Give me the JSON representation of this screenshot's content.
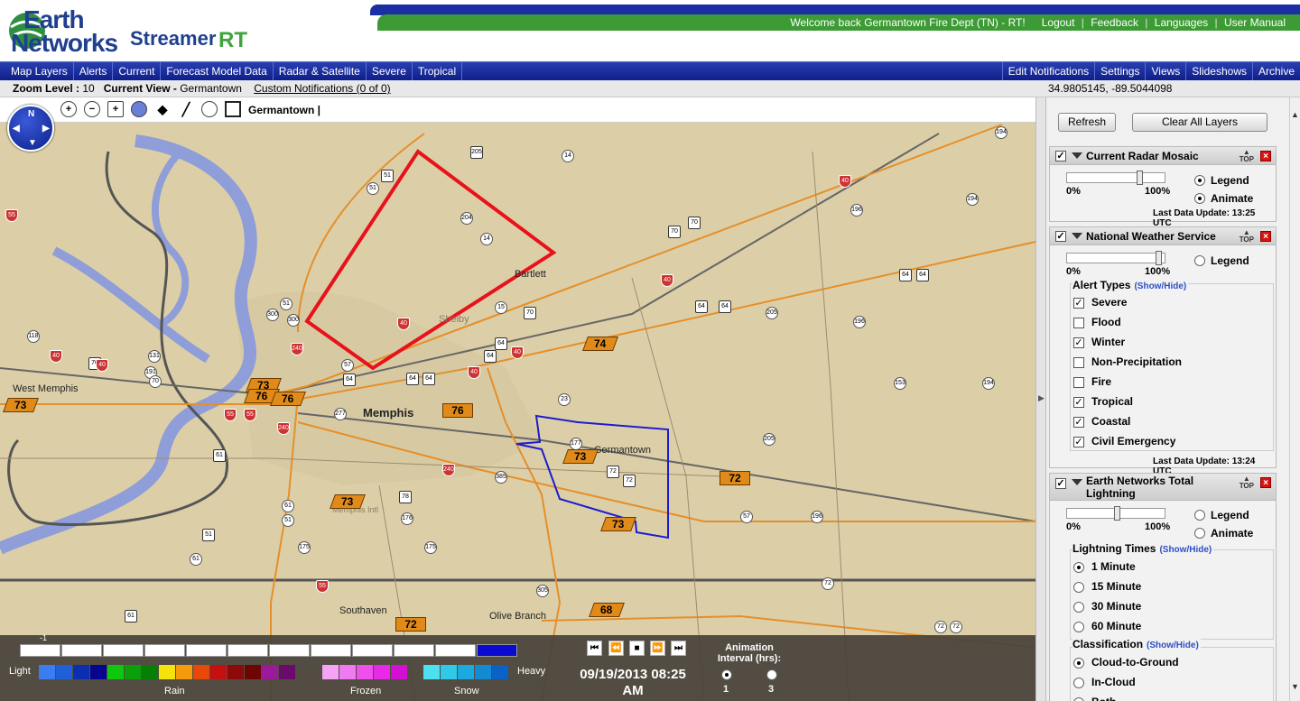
{
  "brand": {
    "line1": "Earth",
    "line2": "Networks",
    "product": "Streamer",
    "suffix": "RT"
  },
  "topbar": {
    "welcome": "Welcome back  Germantown Fire Dept (TN) - RT!",
    "links": [
      "Logout",
      "Feedback",
      "Languages",
      "User Manual"
    ]
  },
  "nav": {
    "left": [
      "Map Layers",
      "Alerts",
      "Current",
      "Forecast Model Data",
      "Radar & Satellite",
      "Severe",
      "Tropical"
    ],
    "right": [
      "Edit Notifications",
      "Settings",
      "Views",
      "Slideshows",
      "Archive"
    ]
  },
  "info": {
    "zoom_label": "Zoom Level :",
    "zoom_value": "10",
    "view_label": "Current View -",
    "view_value": "Germantown",
    "custom_notif": "Custom Notifications (0 of 0)",
    "coords": "34.9805145, -89.5044098"
  },
  "map": {
    "location_label": "Germantown",
    "cities": {
      "memphis": "Memphis",
      "germantown": "Germantown",
      "west_memphis": "West Memphis",
      "bartlett": "Bartlett",
      "southaven": "Southaven",
      "olive_branch": "Olive Branch",
      "memphis_intl": "Memphis Intl",
      "shelby": "Shelby"
    },
    "temps": [
      "73",
      "76",
      "76",
      "73",
      "76",
      "74",
      "73",
      "72",
      "73",
      "73",
      "72",
      "68"
    ],
    "colors": {
      "warning_red": "#e8121b",
      "alert_blue": "#1d1ccf",
      "river": "#8f9ed8",
      "land": "#dccfa8",
      "temp_box": "#e08a1a"
    }
  },
  "legend": {
    "light": "Light",
    "heavy": "Heavy",
    "min_label": "-1",
    "rain": "Rain",
    "frozen": "Frozen",
    "snow": "Snow",
    "rain_colors": [
      "#3b7df0",
      "#1f5fd8",
      "#0a2fb0",
      "#050590",
      "#0ec80e",
      "#0aa00a",
      "#058005",
      "#f5e30c",
      "#f59a0c",
      "#e8480a",
      "#c41010",
      "#8c0a0a",
      "#6e0505",
      "#9b1a9b",
      "#6a0a6a"
    ],
    "frozen_colors": [
      "#f5a3f5",
      "#f07af0",
      "#ee4fee",
      "#e82ae8",
      "#d40fd4"
    ],
    "snow_colors": [
      "#4fe0f0",
      "#2fc9ea",
      "#1aa9e0",
      "#128ad4",
      "#0a63c4"
    ],
    "date": "09/19/2013 08:25",
    "ampm": "AM",
    "anim_title": "Animation Interval (hrs):",
    "anim_opts": [
      "1",
      "3"
    ]
  },
  "sidebar": {
    "refresh": "Refresh",
    "clear_all": "Clear All Layers",
    "top_label": "TOP",
    "radar": {
      "title": "Current Radar Mosaic",
      "pct_min": "0%",
      "pct_max": "100%",
      "opacity": 0.75,
      "legend": "Legend",
      "animate": "Animate",
      "updated": "Last Data Update:  13:25 UTC"
    },
    "nws": {
      "title": "National Weather Service",
      "pct_min": "0%",
      "pct_max": "100%",
      "opacity": 0.95,
      "legend": "Legend",
      "alert_types_label": "Alert Types",
      "show_hide": "(Show/Hide)",
      "alerts": [
        {
          "label": "Severe",
          "checked": true
        },
        {
          "label": "Flood",
          "checked": false
        },
        {
          "label": "Winter",
          "checked": true
        },
        {
          "label": "Non-Precipitation",
          "checked": false
        },
        {
          "label": "Fire",
          "checked": false
        },
        {
          "label": "Tropical",
          "checked": true
        },
        {
          "label": "Coastal",
          "checked": true
        },
        {
          "label": "Civil Emergency",
          "checked": true
        }
      ],
      "updated": "Last Data Update:  13:24 UTC"
    },
    "lightning": {
      "title_1": "Earth Networks Total",
      "title_2": "Lightning",
      "pct_min": "0%",
      "pct_max": "100%",
      "opacity": 0.5,
      "legend": "Legend",
      "animate": "Animate",
      "times_label": "Lightning Times",
      "show_hide": "(Show/Hide)",
      "times": [
        {
          "label": "1 Minute",
          "selected": true
        },
        {
          "label": "15 Minute",
          "selected": false
        },
        {
          "label": "30 Minute",
          "selected": false
        },
        {
          "label": "60 Minute",
          "selected": false
        }
      ],
      "class_label": "Classification",
      "classes": [
        {
          "label": "Cloud-to-Ground",
          "selected": true
        },
        {
          "label": "In-Cloud",
          "selected": false
        },
        {
          "label": "Both",
          "selected": false
        }
      ]
    }
  }
}
